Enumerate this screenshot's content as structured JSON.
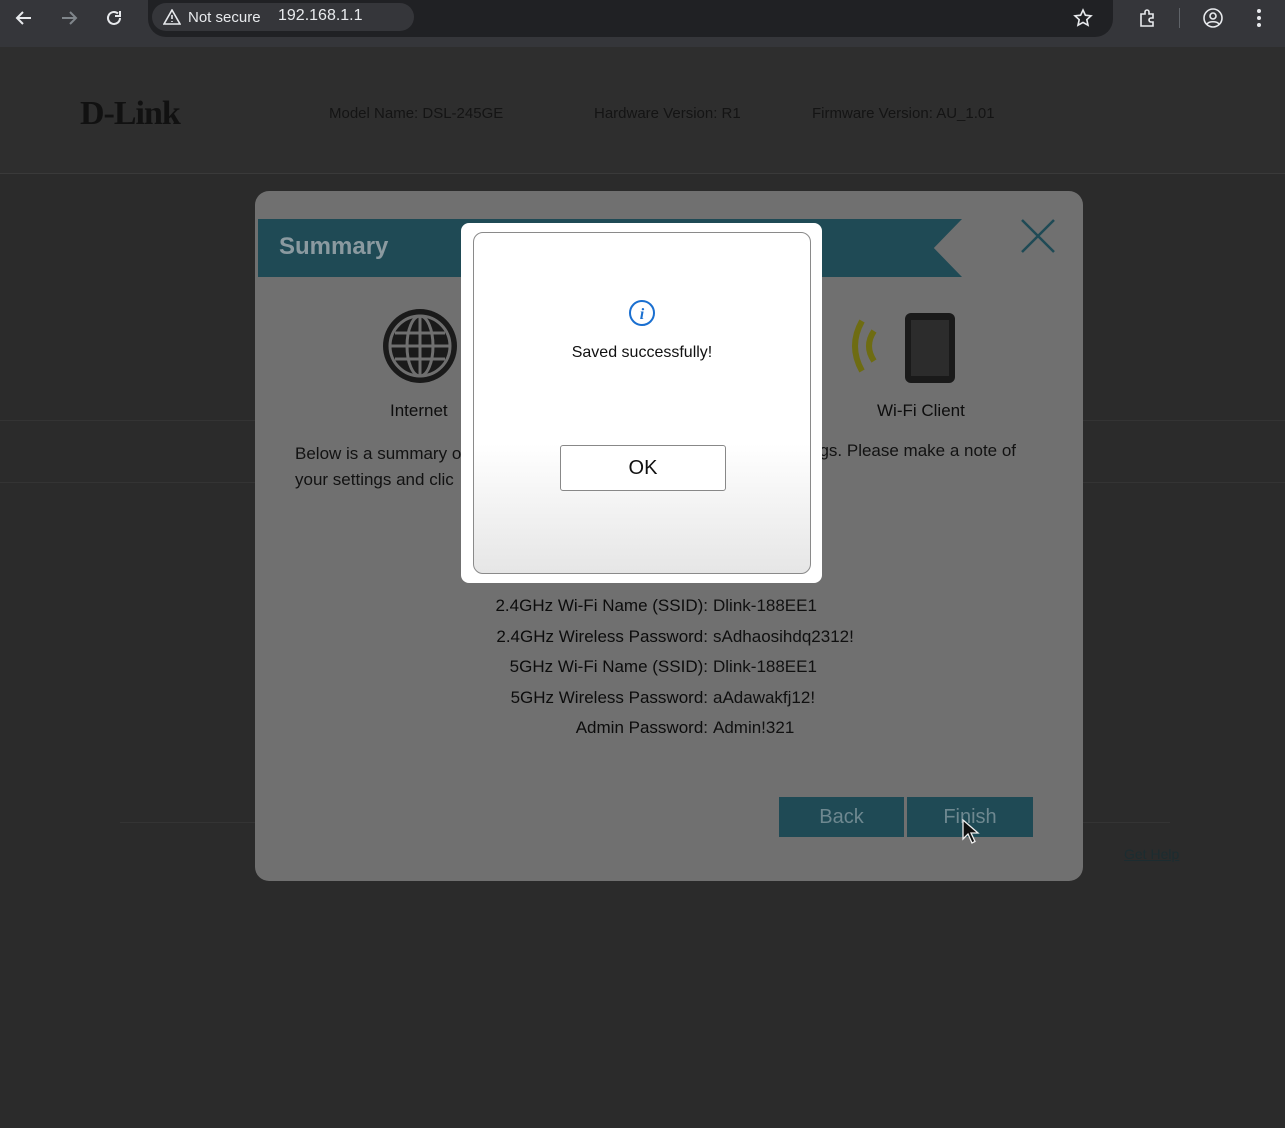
{
  "browser": {
    "security_label": "Not secure",
    "url": "192.168.1.1"
  },
  "header": {
    "logo": "D-Link",
    "model": "Model Name: DSL-245GE",
    "hardware": "Hardware Version: R1",
    "firmware": "Firmware Version: AU_1.01"
  },
  "summary": {
    "title": "Summary",
    "internet_label": "Internet",
    "wifi_client_label": "Wi-Fi Client",
    "desc_line1": "Below is a summary o",
    "desc_line2": "your settings and clic",
    "desc_right": "ngs. Please make a note of",
    "rows": [
      {
        "key": "2.4GHz Wi-Fi Name (SSID):",
        "value": "Dlink-188EE1"
      },
      {
        "key": "2.4GHz Wireless Password:",
        "value": "sAdhaosihdq2312!"
      },
      {
        "key": "5GHz Wi-Fi Name (SSID):",
        "value": "Dlink-188EE1"
      },
      {
        "key": "5GHz Wireless Password:",
        "value": "aAdawakfj12!"
      },
      {
        "key": "Admin Password:",
        "value": "Admin!321"
      }
    ],
    "back_label": "Back",
    "finish_label": "Finish"
  },
  "footer": {
    "get_help": "Get Help"
  },
  "alert": {
    "message": "Saved successfully!",
    "ok_label": "OK"
  },
  "colors": {
    "banner": "#1f4a55",
    "info_icon": "#1a6fd0"
  },
  "icons": [
    "back-icon",
    "forward-icon",
    "reload-icon",
    "warning-icon",
    "star-icon",
    "extensions-icon",
    "profile-icon",
    "menu-icon",
    "globe-icon",
    "wifi-icon",
    "phone-icon",
    "close-icon",
    "info-icon",
    "cursor-icon"
  ]
}
